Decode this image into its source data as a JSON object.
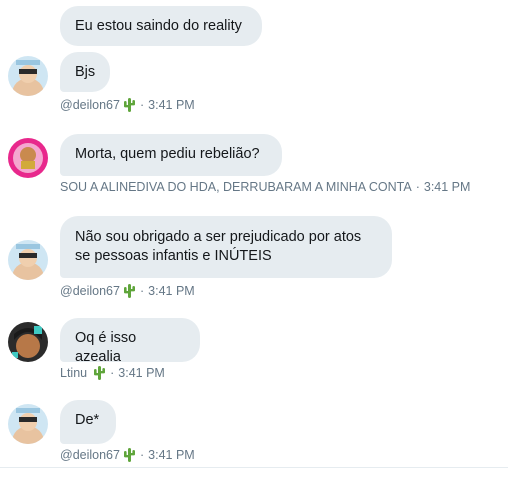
{
  "messages": [
    {
      "text": "Eu estou saindo do reality"
    },
    {
      "text": "Bjs",
      "user": "@deilon67",
      "time": "3:41 PM"
    },
    {
      "text": "Morta, quem pediu rebelião?",
      "user": "SOU A ALINEDIVA DO HDA, DERRUBARAM A MINHA CONTA",
      "time": "3:41 PM"
    },
    {
      "text_line1": "Não sou obrigado a ser prejudicado por atos",
      "text_line2": "se pessoas infantis e INÚTEIS",
      "user": "@deilon67",
      "time": "3:41 PM"
    },
    {
      "text": "Oq é isso azealia",
      "user": "Ltinu",
      "time": "3:41 PM"
    },
    {
      "text": "De*",
      "user": "@deilon67",
      "time": "3:41 PM"
    }
  ],
  "separator": "·",
  "icons": {
    "emoji": "cactus-emoji"
  },
  "colors": {
    "bubble": "#e6ecf0",
    "meta_text": "#657786",
    "cactus": "#5fa53b"
  }
}
